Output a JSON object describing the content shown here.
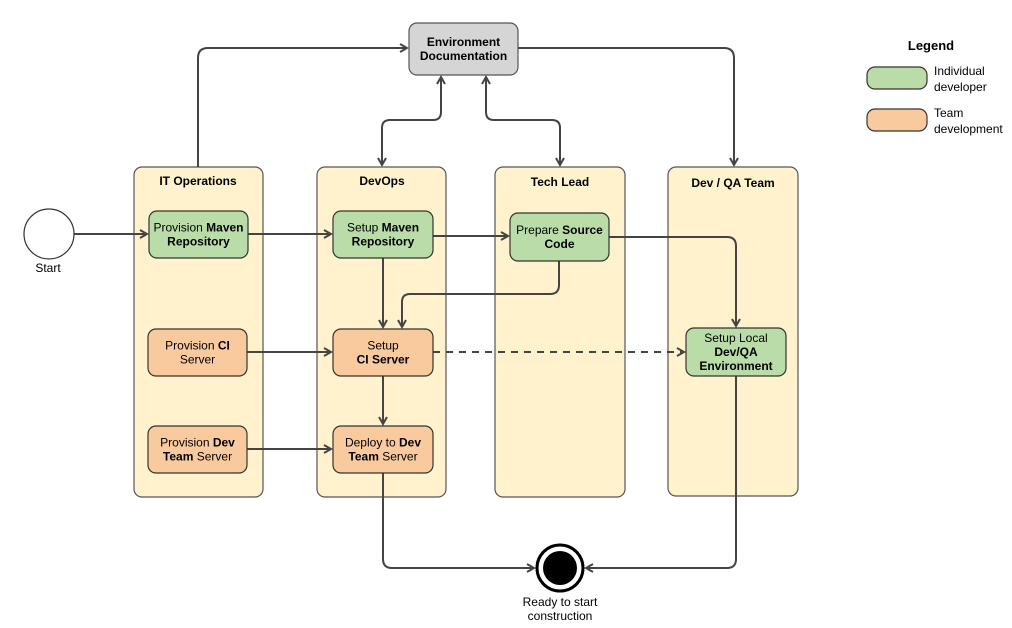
{
  "colors": {
    "individual": "#b9dca8",
    "team": "#f8ca9d",
    "lane": "#fff2cc",
    "documentation": "#d5d5d5"
  },
  "start": {
    "label": "Start"
  },
  "end": {
    "label_lines": [
      "Ready to start",
      "construction"
    ]
  },
  "documentation": {
    "lines": [
      [
        {
          "t": "Environment",
          "b": true
        }
      ],
      [
        {
          "t": "Documentation",
          "b": true
        }
      ]
    ]
  },
  "lanes": [
    {
      "title": "IT Operations"
    },
    {
      "title": "DevOps"
    },
    {
      "title": "Tech Lead"
    },
    {
      "title": "Dev / QA Team"
    }
  ],
  "nodes": [
    {
      "id": "provision-maven",
      "type": "individual",
      "lines": [
        [
          {
            "t": "Provision ",
            "b": false
          },
          {
            "t": "Maven",
            "b": true
          }
        ],
        [
          {
            "t": "Repository",
            "b": true
          }
        ]
      ]
    },
    {
      "id": "setup-maven",
      "type": "individual",
      "lines": [
        [
          {
            "t": "Setup ",
            "b": false
          },
          {
            "t": "Maven",
            "b": true
          }
        ],
        [
          {
            "t": "Repository",
            "b": true
          }
        ]
      ]
    },
    {
      "id": "prepare-source",
      "type": "individual",
      "lines": [
        [
          {
            "t": "Prepare ",
            "b": false
          },
          {
            "t": "Source",
            "b": true
          }
        ],
        [
          {
            "t": "Code",
            "b": true
          }
        ]
      ]
    },
    {
      "id": "provision-ci",
      "type": "team",
      "lines": [
        [
          {
            "t": "Provision ",
            "b": false
          },
          {
            "t": "CI",
            "b": true
          }
        ],
        [
          {
            "t": "Server",
            "b": false
          }
        ]
      ]
    },
    {
      "id": "setup-ci",
      "type": "team",
      "lines": [
        [
          {
            "t": "Setup",
            "b": false
          }
        ],
        [
          {
            "t": "CI Server",
            "b": true
          }
        ]
      ]
    },
    {
      "id": "setup-local",
      "type": "individual",
      "lines": [
        [
          {
            "t": "Setup Local",
            "b": false
          }
        ],
        [
          {
            "t": "Dev/QA",
            "b": true
          }
        ],
        [
          {
            "t": "Environment",
            "b": true
          }
        ]
      ]
    },
    {
      "id": "provision-dev",
      "type": "team",
      "lines": [
        [
          {
            "t": "Provision ",
            "b": false
          },
          {
            "t": "Dev",
            "b": true
          }
        ],
        [
          {
            "t": "Team",
            "b": true
          },
          {
            "t": " Server",
            "b": false
          }
        ]
      ]
    },
    {
      "id": "deploy-dev",
      "type": "team",
      "lines": [
        [
          {
            "t": "Deploy to ",
            "b": false
          },
          {
            "t": "Dev",
            "b": true
          }
        ],
        [
          {
            "t": "Team",
            "b": true
          },
          {
            "t": " Server",
            "b": false
          }
        ]
      ]
    }
  ],
  "legend": {
    "title": "Legend",
    "items": [
      {
        "type": "individual",
        "lines": [
          "Individual",
          "developer"
        ]
      },
      {
        "type": "team",
        "lines": [
          "Team",
          "development"
        ]
      }
    ]
  }
}
